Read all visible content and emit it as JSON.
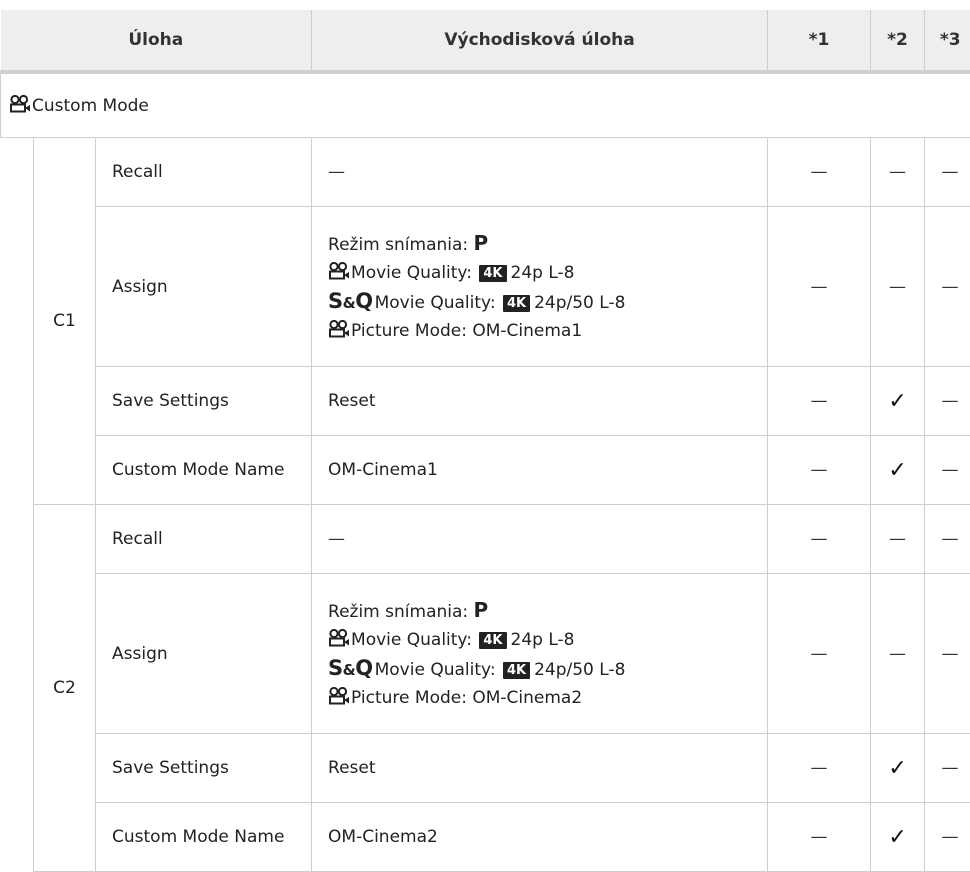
{
  "headers": {
    "task": "Úloha",
    "default": "Východisková úloha",
    "c1": "*1",
    "c2": "*2",
    "c3": "*3"
  },
  "section": {
    "label": "Custom Mode",
    "icon": "movie-camera-icon"
  },
  "symbols": {
    "dash": "—",
    "check": "✓"
  },
  "assign": {
    "mode_label": "Režim snímania:",
    "mode_value": "P",
    "movie_quality_label": "Movie Quality:",
    "badge_4k": "4K",
    "movie_quality_value": "24p L-8",
    "sq_s": "S",
    "sq_amp": "&",
    "sq_q": "Q",
    "sq_quality_label": "Movie Quality:",
    "sq_quality_value": "24p/50 L-8",
    "picture_mode_label": "Picture Mode:"
  },
  "groups": [
    {
      "name": "C1",
      "rows": [
        {
          "name": "Recall",
          "value": "—",
          "c1": "—",
          "c2": "—",
          "c3": "—"
        },
        {
          "name": "Assign",
          "picture_mode": "OM-Cinema1",
          "c1": "—",
          "c2": "—",
          "c3": "—"
        },
        {
          "name": "Save Settings",
          "value": "Reset",
          "c1": "—",
          "c2": "✓",
          "c3": "—"
        },
        {
          "name": "Custom Mode Name",
          "value": "OM-Cinema1",
          "c1": "—",
          "c2": "✓",
          "c3": "—"
        }
      ]
    },
    {
      "name": "C2",
      "rows": [
        {
          "name": "Recall",
          "value": "—",
          "c1": "—",
          "c2": "—",
          "c3": "—"
        },
        {
          "name": "Assign",
          "picture_mode": "OM-Cinema2",
          "c1": "—",
          "c2": "—",
          "c3": "—"
        },
        {
          "name": "Save Settings",
          "value": "Reset",
          "c1": "—",
          "c2": "✓",
          "c3": "—"
        },
        {
          "name": "Custom Mode Name",
          "value": "OM-Cinema2",
          "c1": "—",
          "c2": "✓",
          "c3": "—"
        }
      ]
    }
  ]
}
